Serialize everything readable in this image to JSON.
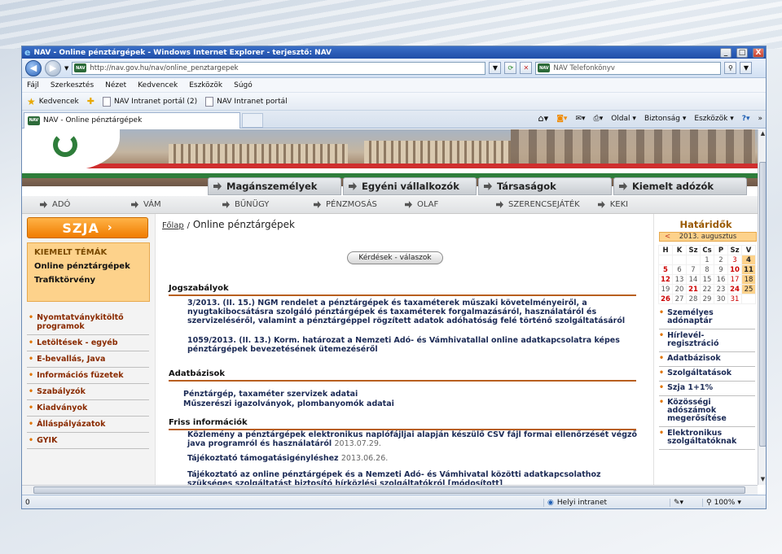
{
  "window": {
    "title": "NAV - Online pénztárgépek - Windows Internet Explorer - terjesztő: NAV",
    "minimize": "_",
    "maximize": "□",
    "close": "X"
  },
  "address": {
    "url": "http://nav.gov.hu/nav/online_penztargepek",
    "search_placeholder": "NAV Telefonkönyv"
  },
  "menu": [
    "Fájl",
    "Szerkesztés",
    "Nézet",
    "Kedvencek",
    "Eszközök",
    "Súgó"
  ],
  "favorites": {
    "label": "Kedvencek",
    "items": [
      "NAV Intranet portál (2)",
      "NAV Intranet portál"
    ]
  },
  "tab": {
    "label": "NAV - Online pénztárgépek"
  },
  "commandbar": {
    "page": "Oldal",
    "safety": "Biztonság",
    "tools": "Eszközök",
    "more": "»"
  },
  "site": {
    "main_tabs": [
      "Magánszemélyek",
      "Egyéni vállalkozók",
      "Társaságok",
      "Kiemelt adózók"
    ],
    "subnav": [
      "ADÓ",
      "VÁM",
      "BŰNÜGY",
      "PÉNZMOSÁS",
      "OLAF",
      "SZERENCSEJÁTÉK",
      "KEKI"
    ],
    "szja": "SZJA",
    "kiemelt": {
      "title": "KIEMELT TÉMÁK",
      "items": [
        "Online pénztárgépek",
        "Trafiktörvény"
      ]
    },
    "left_links": [
      "Nyomtatványkitöltő programok",
      "Letöltések - egyéb",
      "E-bevallás, Java",
      "Információs füzetek",
      "Szabályzók",
      "Kiadványok",
      "Álláspályázatok",
      "GYIK"
    ],
    "breadcrumb": {
      "home": "Főlap",
      "sep": "/",
      "current": "Online pénztárgépek"
    },
    "qa_button": "Kérdések - válaszok",
    "sections": {
      "jog": {
        "title": "Jogszabályok",
        "p1": "3/2013. (II. 15.) NGM rendelet a pénztárgépek és taxaméterek műszaki követelményeiről, a nyugtakibocsátásra szolgáló pénztárgépek és taxaméterek forgalmazásáról, használatáról és szervizeléséről, valamint a pénztárgéppel rögzített adatok adóhatóság felé történő szolgáltatásáról",
        "p2": "1059/2013. (II. 13.) Korm. határozat a Nemzeti Adó- és Vámhivatallal online adatkapcsolatra képes pénztárgépek bevezetésének ütemezéséről"
      },
      "adat": {
        "title": "Adatbázisok",
        "l1": "Pénztárgép, taxaméter szervizek adatai",
        "l2": "Műszerészi igazolványok, plombanyomók adatai"
      },
      "friss": {
        "title": "Friss információk",
        "n1": "Közlemény a pénztárgépek elektronikus naplófájljai alapján készülő CSV fájl formai ellenőrzését végző java programról és használatáról",
        "n1d": "2013.07.29.",
        "n2": "Tájékoztató támogatásigényléshez",
        "n2d": "2013.06.26.",
        "n3": "Tájékoztató az online pénztárgépek és a Nemzeti Adó- és Vámhivatal közötti adatkapcsolathoz szükséges szolgáltatást biztosító hírközlési szolgáltatókról [módosított]"
      }
    },
    "deadlines": {
      "title": "Határidők",
      "month": "2013. augusztus",
      "prev": "<",
      "weekdays": [
        "H",
        "K",
        "Sz",
        "Cs",
        "P",
        "Sz",
        "V"
      ],
      "weeks": [
        [
          "",
          "",
          "",
          "1",
          "2",
          "3",
          "4"
        ],
        [
          "5",
          "6",
          "7",
          "8",
          "9",
          "10",
          "11"
        ],
        [
          "12",
          "13",
          "14",
          "15",
          "16",
          "17",
          "18"
        ],
        [
          "19",
          "20",
          "21",
          "22",
          "23",
          "24",
          "25"
        ],
        [
          "26",
          "27",
          "28",
          "29",
          "30",
          "31",
          ""
        ]
      ]
    },
    "right_links": [
      "Személyes adónaptár",
      "Hírlevél-regisztráció",
      "Adatbázisok",
      "Szolgáltatások",
      "Szja 1+1%",
      "Közösségi adószámok megerősítése",
      "Elektronikus szolgáltatóknak"
    ]
  },
  "status": {
    "left": "0",
    "zone": "Helyi intranet",
    "zoom": "100%"
  }
}
